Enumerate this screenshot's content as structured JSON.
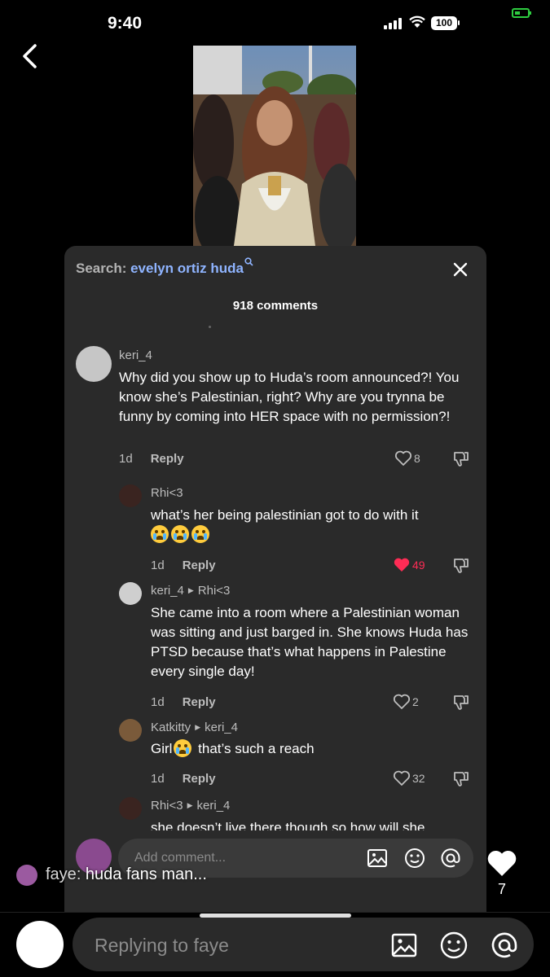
{
  "status_bar": {
    "time": "9:40",
    "battery": "100"
  },
  "search": {
    "prefix": "Search: ",
    "query": "evelyn ortiz huda"
  },
  "comments_count": "918 comments",
  "comments": [
    {
      "user": "keri_4",
      "reply_to": "",
      "text": "Why did you show up to Huda’s room announced?! You know she’s Palestinian, right? Why are you trynna be funny by coming into HER space with no permission?!",
      "age": "1d",
      "reply_label": "Reply",
      "likes": "8",
      "liked": false
    },
    {
      "user": "Rhi<3",
      "reply_to": "",
      "text": "what’s her being palestinian got to do with it",
      "age": "1d",
      "reply_label": "Reply",
      "likes": "49",
      "liked": true
    },
    {
      "user": "keri_4",
      "reply_to": "Rhi<3",
      "text": "She came into a room where a Palestinian woman was sitting and just barged in. She knows Huda has PTSD because that’s what happens in Palestine every single day!",
      "age": "1d",
      "reply_label": "Reply",
      "likes": "2",
      "liked": false
    },
    {
      "user": "Katkitty",
      "reply_to": "keri_4",
      "text_before": "Girl",
      "text_after": " that’s such a reach",
      "age": "1d",
      "reply_label": "Reply",
      "likes": "32",
      "liked": false
    },
    {
      "user": "Rhi<3",
      "reply_to": "keri_4",
      "text": "she doesn’t live there though so how will she"
    }
  ],
  "add_comment": {
    "placeholder": "Add comment..."
  },
  "live_message": {
    "user": "faye",
    "separator": ":",
    "text": " huda fans man..."
  },
  "live_likes": "7",
  "reply_bar": {
    "placeholder": "Replying to faye"
  },
  "colors": {
    "accent_link": "#8fb4ff",
    "like_red": "#fe2c55",
    "panel_bg": "#2a2a2a"
  }
}
